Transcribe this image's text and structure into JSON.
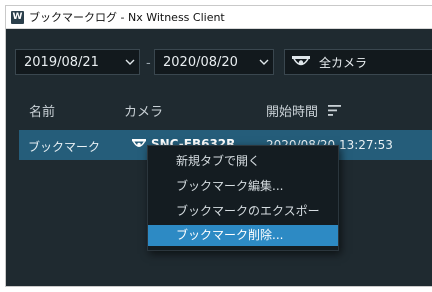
{
  "window": {
    "title": "ブックマークログ - Nx Witness Client",
    "icon": "nx-witness-logo-icon",
    "icon_letter": "W"
  },
  "filters": {
    "start_date": "2019/08/21",
    "end_date": "2020/08/20",
    "separator": "-",
    "camera_filter": "全カメラ"
  },
  "table": {
    "headers": {
      "name": "名前",
      "camera": "カメラ",
      "start_time": "開始時間"
    },
    "sort": "descending",
    "rows": [
      {
        "name": "ブックマーク",
        "camera": "SNC-EB632R",
        "start_time": "2020/08/20 13:27:53",
        "selected": true
      }
    ]
  },
  "context_menu": {
    "items": [
      {
        "label": "新規タブで開く",
        "highlighted": false
      },
      {
        "label": "ブックマーク編集...",
        "highlighted": false
      },
      {
        "label": "ブックマークのエクスポート...",
        "highlighted": false
      },
      {
        "label": "ブックマーク削除...",
        "highlighted": true
      }
    ]
  },
  "colors": {
    "background": "#1f2a30",
    "selected_row": "#255d7a",
    "menu_highlight": "#2d8ac4",
    "menu_background": "#141c21"
  }
}
